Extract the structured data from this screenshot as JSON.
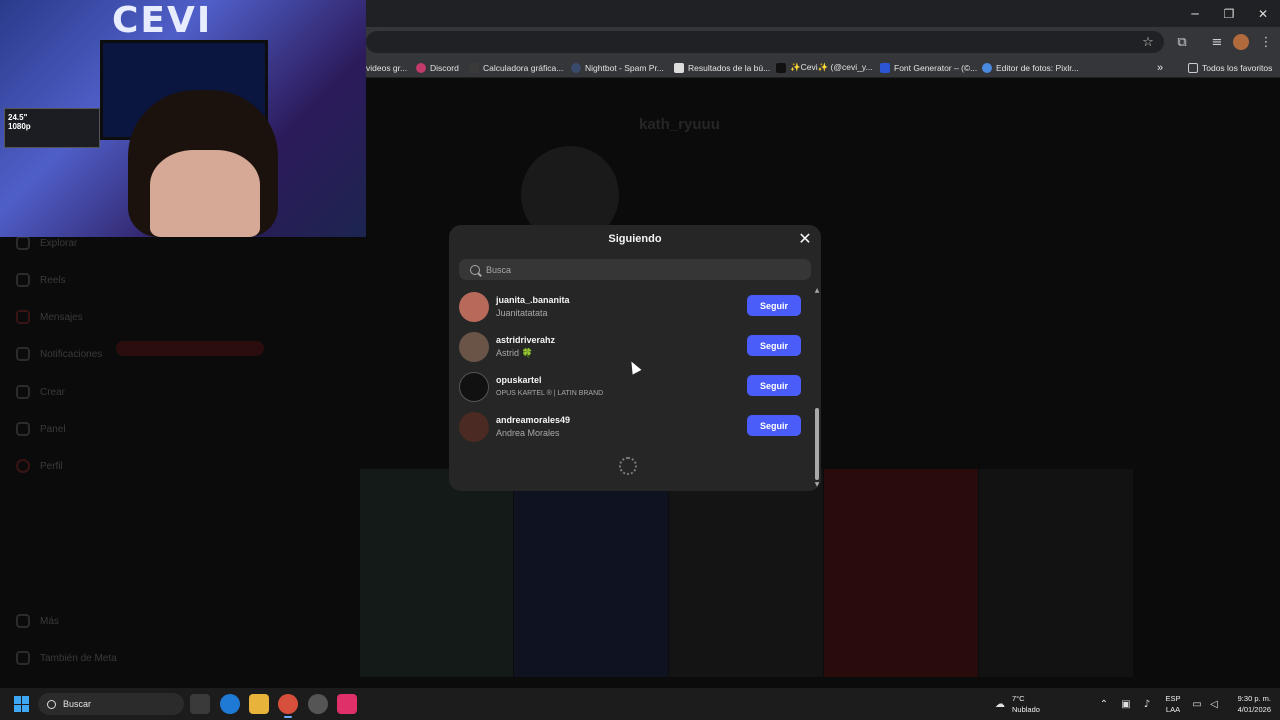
{
  "browser": {
    "window_controls": {
      "minimize": "─",
      "restore": "❐",
      "close": "✕"
    },
    "bookmarks": [
      {
        "label": "videos gr...",
        "icon_color": "#555555"
      },
      {
        "label": "Discord",
        "icon_color": "#c23a6a"
      },
      {
        "label": "Calculadora gráfica...",
        "icon_color": "#3a3a3a"
      },
      {
        "label": "Nightbot - Spam Pr...",
        "icon_color": "#3a4a6a"
      },
      {
        "label": "Resultados de la bú...",
        "icon_color": "#dddddd"
      },
      {
        "label": "✨Cevi✨ (@cevi_y...",
        "icon_color": "#111111"
      },
      {
        "label": "Font Generator – (©...",
        "icon_color": "#2a55d4"
      },
      {
        "label": "Editor de fotos: Pixlr...",
        "icon_color": "#4a8ae0"
      }
    ],
    "bookmarks_overflow": "»",
    "all_favorites": "Todos los favoritos"
  },
  "webcam": {
    "logo": "CEVI",
    "monitor_label": "24.5\"\n1080p"
  },
  "background_page": {
    "profile_name": "kath_ryuuu",
    "sidebar": [
      "Explorar",
      "Reels",
      "Mensajes",
      "Notificaciones",
      "Crear",
      "Panel",
      "Perfil",
      "Más",
      "También de Meta"
    ]
  },
  "modal": {
    "title": "Siguiendo",
    "close_icon": "✕",
    "search_placeholder": "Busca",
    "follow_label": "Seguir",
    "users": [
      {
        "username": "juanita_.bananita",
        "full_name": "Juanitatatata",
        "avatar_color": "#b86a5a"
      },
      {
        "username": "astridriverahz",
        "full_name": "Astrid 🍀",
        "avatar_color": "#6a5448"
      },
      {
        "username": "opuskartel",
        "full_name": "OPUS KARTEL ® | LATIN BRAND",
        "avatar_color": "#111111"
      },
      {
        "username": "andreamorales49",
        "full_name": "Andrea Morales",
        "avatar_color": "#4a2a22"
      }
    ]
  },
  "taskbar": {
    "search_label": "Buscar",
    "weather_temp": "7°C",
    "weather_desc": "Nublado",
    "lang_1": "ESP",
    "lang_2": "LAA",
    "time": "9:30 p. m.",
    "date": "4/01/2026"
  }
}
